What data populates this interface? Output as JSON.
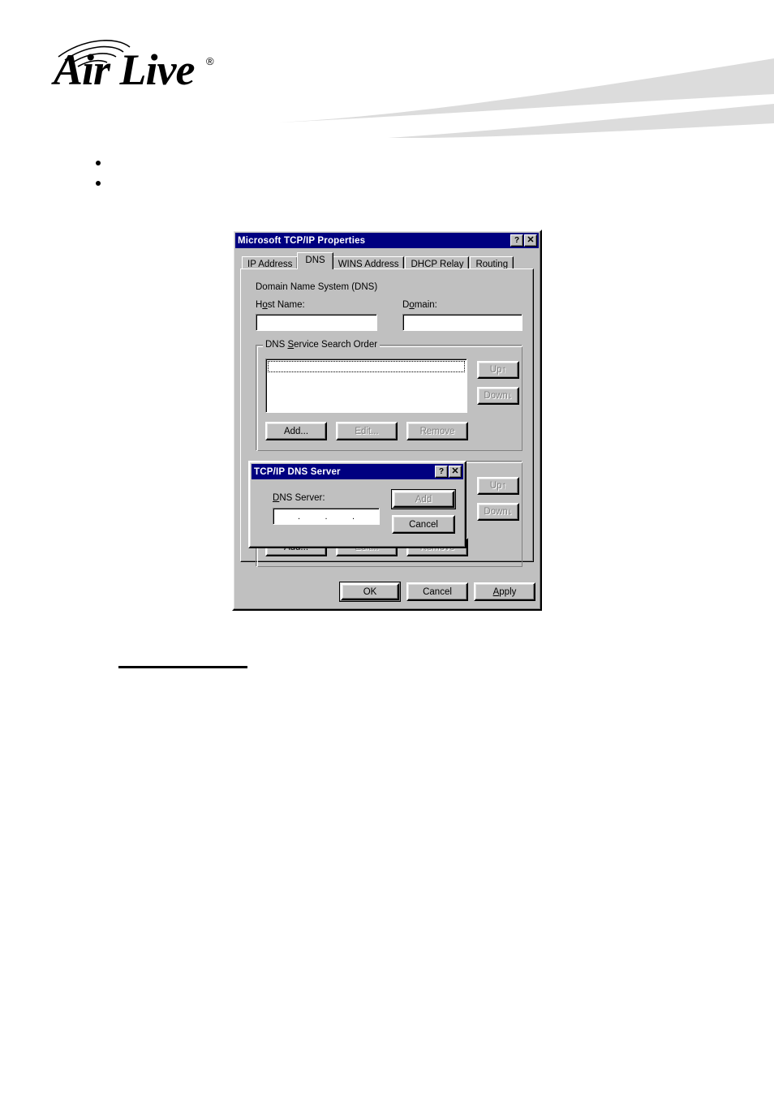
{
  "page": {
    "brand_name": "Air Live",
    "brand_trademark": "®",
    "rule_label": ""
  },
  "bullets": [
    {
      "text": ""
    },
    {
      "text": ""
    }
  ],
  "dialog": {
    "title": "Microsoft TCP/IP Properties",
    "help_button": "?",
    "close_button": "✕",
    "tabs": [
      {
        "label": "IP Address",
        "selected": false
      },
      {
        "label": "DNS",
        "selected": true
      },
      {
        "label": "WINS Address",
        "selected": false
      },
      {
        "label": "DHCP Relay",
        "selected": false
      },
      {
        "label": "Routing",
        "selected": false
      }
    ],
    "section_title": "Domain Name System (DNS)",
    "host_name": {
      "label_pre": "H",
      "label_accel": "o",
      "label_post": "st Name:",
      "value": "",
      "placeholder": ""
    },
    "domain": {
      "label_pre": "D",
      "label_accel": "o",
      "label_post": "main:",
      "value": "",
      "placeholder": ""
    },
    "search_order": {
      "group_pre": "DNS ",
      "group_accel": "S",
      "group_post": "ervice Search Order",
      "items": [],
      "up_button": "Up↑",
      "down_button": "Down↓",
      "add_button": "Add...",
      "edit_button": "Edit...",
      "remove_button": "Remove"
    },
    "footer": {
      "ok_button": "OK",
      "cancel_button": "Cancel",
      "apply_pre": "",
      "apply_accel": "A",
      "apply_post": "pply"
    }
  },
  "modal": {
    "title": "TCP/IP DNS Server",
    "help_button": "?",
    "close_button": "✕",
    "server_label_pre": "",
    "server_label_accel": "D",
    "server_label_post": "NS Server:",
    "server_value": "",
    "ip_separator": ".",
    "add_button": "Add",
    "cancel_button": "Cancel"
  },
  "colors": {
    "titlebar": "#000080",
    "face": "#c0c0c0",
    "field": "#ffffff",
    "disabled_text": "#808080",
    "swoosh": "#dcdcdc"
  }
}
